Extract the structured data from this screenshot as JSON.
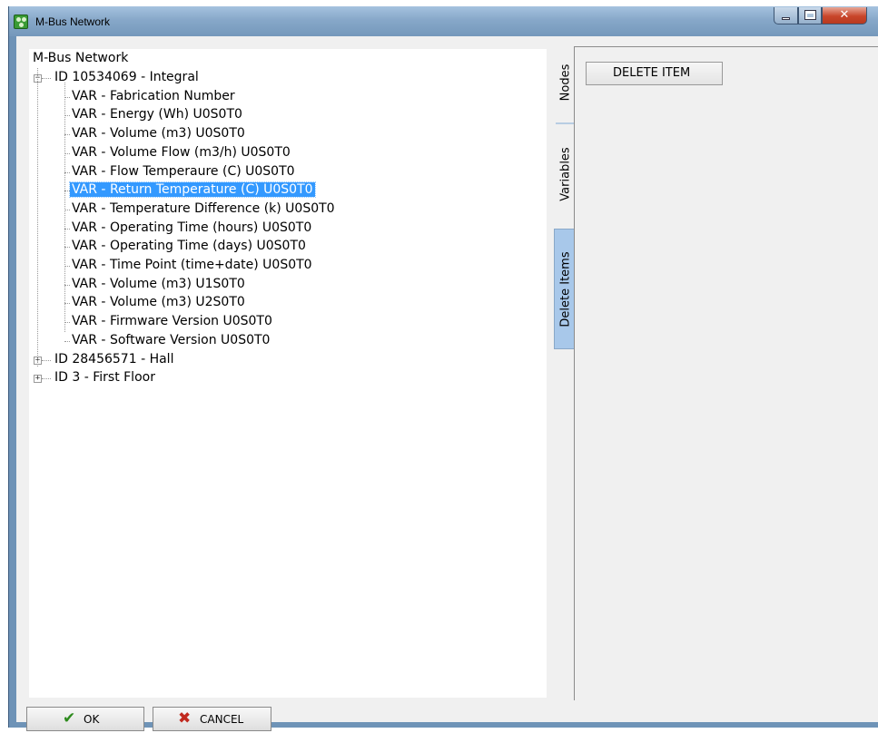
{
  "window": {
    "title": "M-Bus Network"
  },
  "tree": {
    "root_label": "M-Bus Network",
    "nodes": [
      {
        "label": "ID 10534069 - Integral",
        "expander": "−"
      },
      {
        "label": "VAR - Fabrication Number"
      },
      {
        "label": "VAR - Energy (Wh) U0S0T0"
      },
      {
        "label": "VAR - Volume (m3) U0S0T0"
      },
      {
        "label": "VAR - Volume Flow (m3/h) U0S0T0"
      },
      {
        "label": "VAR - Flow Temperaure (C) U0S0T0"
      },
      {
        "label": "VAR - Return Temperature (C) U0S0T0",
        "selected": true
      },
      {
        "label": "VAR - Temperature Difference (k) U0S0T0"
      },
      {
        "label": "VAR - Operating Time (hours) U0S0T0"
      },
      {
        "label": "VAR - Operating Time (days) U0S0T0"
      },
      {
        "label": "VAR - Time Point (time+date) U0S0T0"
      },
      {
        "label": "VAR - Volume (m3) U1S0T0"
      },
      {
        "label": "VAR - Volume (m3) U2S0T0"
      },
      {
        "label": "VAR - Firmware Version U0S0T0"
      },
      {
        "label": "VAR - Software Version U0S0T0"
      },
      {
        "label": "ID 28456571 - Hall",
        "expander": "+"
      },
      {
        "label": "ID 3 - First Floor",
        "expander": "+"
      }
    ]
  },
  "tabs": [
    {
      "label": "Nodes",
      "active": false
    },
    {
      "label": "Variables",
      "active": false
    },
    {
      "label": "Delete Items",
      "active": true
    }
  ],
  "right_panel": {
    "delete_button": "DELETE ITEM"
  },
  "footer": {
    "ok": {
      "label": "OK",
      "icon": "checkmark-icon",
      "color": "#2e8b1e"
    },
    "cancel": {
      "label": "CANCEL",
      "icon": "x-icon",
      "color": "#c0281e"
    }
  }
}
